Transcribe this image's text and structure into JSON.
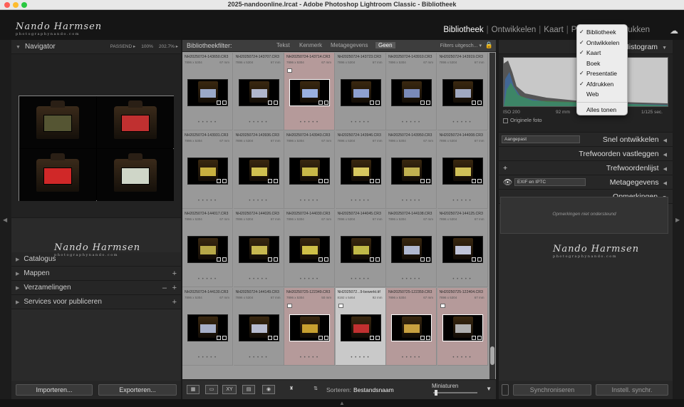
{
  "window": {
    "title": "2025-nandoonline.lrcat - Adobe Photoshop Lightroom Classic - Bibliotheek"
  },
  "brand": {
    "signature": "Nando Harmsen",
    "subline": "photographynando.com"
  },
  "modules": [
    "Bibliotheek",
    "Ontwikkelen",
    "Kaart",
    "P",
    "rukken"
  ],
  "left": {
    "navigator": {
      "title": "Navigator",
      "zoom": [
        "PASSEND ▸",
        "100%",
        "202.7% ▸"
      ]
    },
    "sections": [
      {
        "label": "Catalogus",
        "plus": "",
        "minus": ""
      },
      {
        "label": "Mappen",
        "plus": "+",
        "minus": ""
      },
      {
        "label": "Verzamelingen",
        "plus": "+",
        "minus": "–"
      },
      {
        "label": "Services voor publiceren",
        "plus": "+",
        "minus": ""
      }
    ],
    "buttons": {
      "import": "Importeren...",
      "export": "Exporteren..."
    }
  },
  "filterbar": {
    "label": "Bibliotheekfilter:",
    "tabs": [
      "Tekst",
      "Kenmerk",
      "Metagegevens",
      "Geen"
    ],
    "active": "Geen",
    "right": "Filters uitgesch... ▾"
  },
  "grid": {
    "cells": [
      {
        "name": "NH20250724-143650.CR3",
        "dims": "7896 x 5304",
        "lens": "67 mm",
        "state": "",
        "flag": false,
        "screen": "#9aa8c8"
      },
      {
        "name": "NH20250724-143707.CR3",
        "dims": "7896 x 5304",
        "lens": "67 mm",
        "state": "",
        "flag": false,
        "screen": "#b0b6cc"
      },
      {
        "name": "NH20250724-143714.CR3",
        "dims": "7896 x 5304",
        "lens": "67 mm",
        "state": "sel",
        "flag": true,
        "screen": "#9ab0e0"
      },
      {
        "name": "NH20250724-143723.CR3",
        "dims": "7896 x 5304",
        "lens": "67 mm",
        "state": "",
        "flag": false,
        "screen": "#8ea0d0"
      },
      {
        "name": "NH20250724-143910.CR3",
        "dims": "7896 x 5304",
        "lens": "67 mm",
        "state": "",
        "flag": false,
        "screen": "#7a8ab8"
      },
      {
        "name": "NH20250724-143919.CR3",
        "dims": "7896 x 5304",
        "lens": "67 mm",
        "state": "",
        "flag": false,
        "screen": "#a0a8c0"
      },
      {
        "name": "NH20250724-143931.CR3",
        "dims": "7896 x 5304",
        "lens": "67 mm",
        "state": "",
        "flag": false,
        "screen": "#c8b040"
      },
      {
        "name": "NH20250724-143936.CR3",
        "dims": "7896 x 5304",
        "lens": "67 mm",
        "state": "",
        "flag": false,
        "screen": "#d0c050"
      },
      {
        "name": "NH20250724-143943.CR3",
        "dims": "7896 x 5304",
        "lens": "67 mm",
        "state": "",
        "flag": false,
        "screen": "#c8b848"
      },
      {
        "name": "NH20250724-143946.CR3",
        "dims": "7896 x 5304",
        "lens": "67 mm",
        "state": "",
        "flag": false,
        "screen": "#d8c860"
      },
      {
        "name": "NH20250724-143950.CR3",
        "dims": "7896 x 5304",
        "lens": "67 mm",
        "state": "",
        "flag": false,
        "screen": "#c0b050"
      },
      {
        "name": "NH20250724-144008.CR3",
        "dims": "7896 x 5304",
        "lens": "67 mm",
        "state": "",
        "flag": false,
        "screen": "#d0c058"
      },
      {
        "name": "NH20250724-144017.CR3",
        "dims": "7896 x 5304",
        "lens": "67 mm",
        "state": "",
        "flag": false,
        "screen": "#b8a848"
      },
      {
        "name": "NH20250724-144026.CR3",
        "dims": "7896 x 5304",
        "lens": "67 mm",
        "state": "",
        "flag": false,
        "screen": "#c8b850"
      },
      {
        "name": "NH20250724-144030.CR3",
        "dims": "7896 x 5304",
        "lens": "67 mm",
        "state": "",
        "flag": false,
        "screen": "#d0c048"
      },
      {
        "name": "NH20250724-144045.CR3",
        "dims": "7896 x 5304",
        "lens": "67 mm",
        "state": "",
        "flag": false,
        "screen": "#c0b848"
      },
      {
        "name": "NH20250724-144108.CR3",
        "dims": "7896 x 5304",
        "lens": "67 mm",
        "state": "",
        "flag": false,
        "screen": "#b0b8d0"
      },
      {
        "name": "NH20250724-144125.CR3",
        "dims": "7896 x 5304",
        "lens": "67 mm",
        "state": "",
        "flag": false,
        "screen": "#c0c4d8"
      },
      {
        "name": "NH20250724-144130.CR3",
        "dims": "7896 x 5304",
        "lens": "67 mm",
        "state": "",
        "flag": false,
        "screen": "#a8b0c8"
      },
      {
        "name": "NH20250724-144149.CR3",
        "dims": "7896 x 5304",
        "lens": "67 mm",
        "state": "",
        "flag": false,
        "screen": "#b8bcd0"
      },
      {
        "name": "NH20250725-122349.CR3",
        "dims": "7896 x 5304",
        "lens": "50 mm",
        "state": "sel",
        "flag": true,
        "screen": "#c8a030"
      },
      {
        "name": "NH2025072...9-bewerkt.tif",
        "dims": "8192 x 5464",
        "lens": "92 mm",
        "state": "hi",
        "flag": true,
        "screen": "#c03030"
      },
      {
        "name": "NH20250725-122359.CR3",
        "dims": "7896 x 5304",
        "lens": "67 mm",
        "state": "sel",
        "flag": false,
        "screen": "#c8a040"
      },
      {
        "name": "NH20250725-122404.CR3",
        "dims": "7896 x 5304",
        "lens": "67 mm",
        "state": "sel",
        "flag": true,
        "screen": "#b0b0b0"
      }
    ]
  },
  "toolbar": {
    "sort_label": "Sorteren:",
    "sort_value": "Bestandsnaam",
    "thumbs_label": "Miniaturen"
  },
  "right": {
    "histogram": {
      "title": "Histogram",
      "iso": "ISO 200",
      "focal": "92 mm",
      "shutter": "1/125 sec.",
      "original": "Originele foto"
    },
    "quick_develop": {
      "preset": "Aangepast",
      "title": "Snel ontwikkelen"
    },
    "keywording": "Trefwoorden vastleggen",
    "keyword_list": "Trefwoordenlijst",
    "metadata": {
      "preset": "EXIF en IPTC",
      "title": "Metagegevens"
    },
    "comments": {
      "title": "Opmerkingen",
      "note": "Opmerkingen niet ondersteund"
    },
    "buttons": {
      "sync": "Synchroniseren",
      "sync_settings": "Instell. synchr."
    }
  },
  "module_menu": {
    "items": [
      {
        "label": "Bibliotheek",
        "checked": true
      },
      {
        "label": "Ontwikkelen",
        "checked": true
      },
      {
        "label": "Kaart",
        "checked": true
      },
      {
        "label": "Boek",
        "checked": false
      },
      {
        "label": "Presentatie",
        "checked": true
      },
      {
        "label": "Afdrukken",
        "checked": true
      },
      {
        "label": "Web",
        "checked": false
      }
    ],
    "show_all": "Alles tonen"
  }
}
